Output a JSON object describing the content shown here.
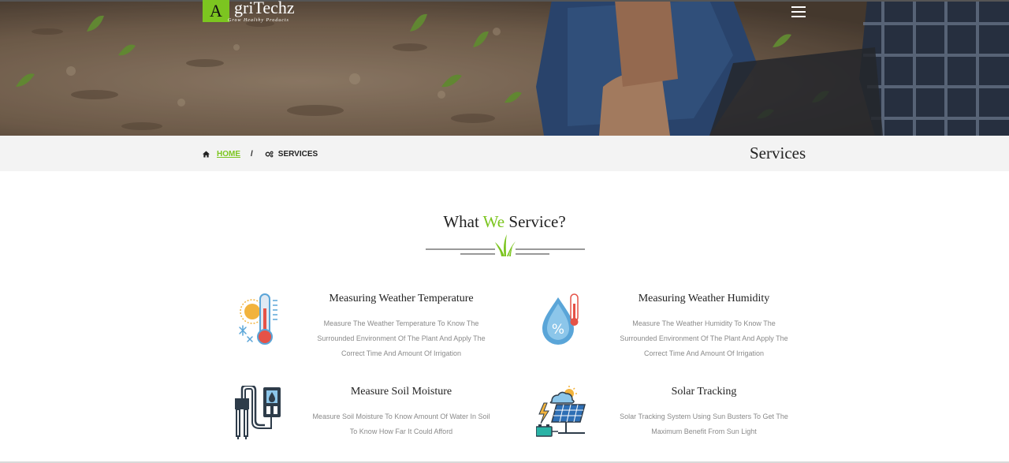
{
  "header": {
    "logo": {
      "initial": "A",
      "rest": "griTechz",
      "tagline": "Grow Healthy Products"
    },
    "menu_icon": "hamburger-icon"
  },
  "breadcrumb": {
    "home_icon": "home-icon",
    "home_label": "HOME",
    "separator": "/",
    "current_icon": "gears-icon",
    "current_label": "SERVICES"
  },
  "page_title": "Services",
  "section": {
    "title_part1": "What",
    "title_accent": "We",
    "title_part2": "Service?",
    "accent_color": "#7cc520",
    "divider_icon": "grass-icon"
  },
  "services": [
    {
      "icon": "thermometer-weather-icon",
      "title": "Measuring Weather Temperature",
      "description": "Measure The Weather Temperature To Know The Surrounded Environment Of The Plant And Apply The Correct Time And Amount Of Irrigation"
    },
    {
      "icon": "humidity-drop-icon",
      "title": "Measuring Weather Humidity",
      "description": "Measure The Weather Humidity To Know The Surrounded Environment Of The Plant And Apply The Correct Time And Amount Of Irrigation"
    },
    {
      "icon": "soil-moisture-sensor-icon",
      "title": "Measure Soil Moisture",
      "description": "Measure Soil Moisture To Know Amount Of Water In Soil To Know How Far It Could Afford"
    },
    {
      "icon": "solar-panel-icon",
      "title": "Solar Tracking",
      "description": "Solar Tracking System Using Sun Busters To Get The Maximum Benefit From Sun Light"
    }
  ]
}
